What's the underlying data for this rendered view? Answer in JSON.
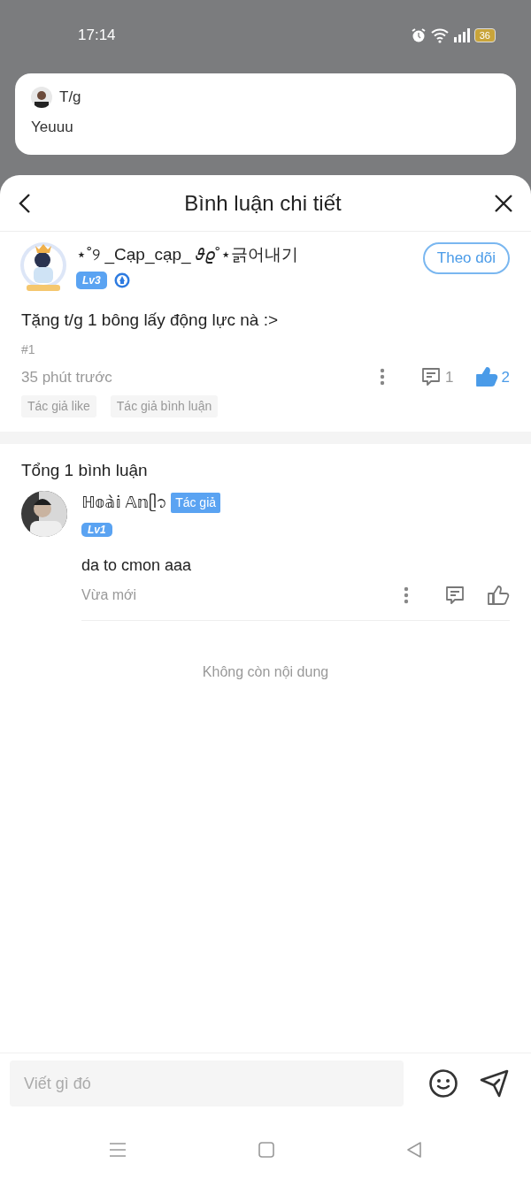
{
  "status_bar": {
    "time": "17:14",
    "battery": "36"
  },
  "notification": {
    "sender": "T/g",
    "message": "Yeuuu"
  },
  "sheet": {
    "title": "Bình luận chi tiết"
  },
  "post": {
    "author": "⋆˚୨ _Cạp_cạp_ 𝜗𝜚˚⋆긁어내기",
    "level": "Lv3",
    "follow_label": "Theo dõi",
    "text": "Tặng t/g 1 bông lấy động lực nà :>",
    "number": "#1",
    "time": "35 phút trước",
    "comment_count": "1",
    "like_count": "2",
    "liked": true,
    "tags": [
      "Tác giả like",
      "Tác giả bình luận"
    ]
  },
  "replies_header": "Tổng 1 bình luận",
  "replies": [
    {
      "author": "ℍ𝕠𝕒̀𝕚   𝔸𝕟ᥫ᭡",
      "badge": "Tác giả",
      "level": "Lv1",
      "text": "da to cmon aaa",
      "time": "Vừa mới",
      "liked": false
    }
  ],
  "end_note": "Không còn nội dung",
  "composer": {
    "placeholder": "Viết gì đó"
  }
}
